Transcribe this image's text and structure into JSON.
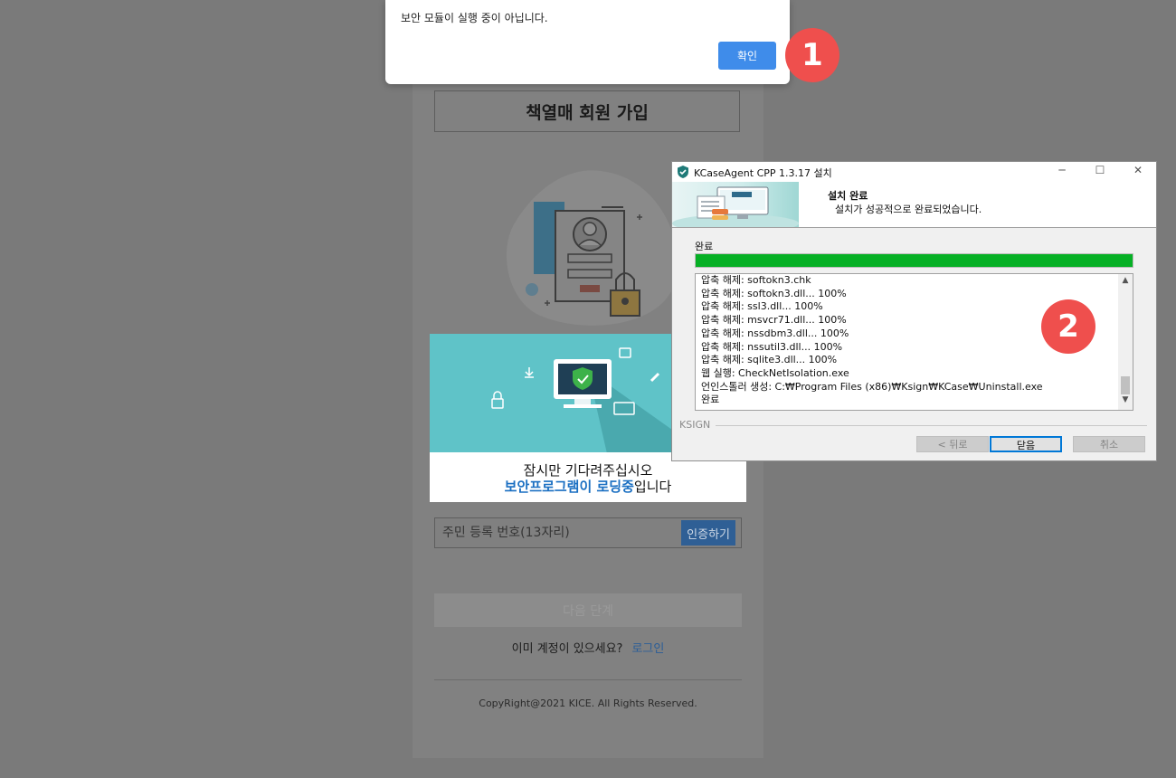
{
  "signup": {
    "title": "책열매 회원 가입",
    "loader_line1": "잠시만 기다려주십시오",
    "loader_highlight": "보안프로그램이 로딩중",
    "loader_suffix": "입니다",
    "id_placeholder": "주민 등록 번호(13자리)",
    "verify_label": "인증하기",
    "next_label": "다음 단계",
    "login_question": "이미 계정이 있으세요?",
    "login_link": "로그인",
    "copyright": "CopyRight@2021 KICE. All Rights Reserved."
  },
  "alert": {
    "message": "보안 모듈이 실행 중이 아닙니다.",
    "ok_label": "확인"
  },
  "badges": [
    "1",
    "2"
  ],
  "installer": {
    "window_title": "KCaseAgent CPP 1.3.17 설치",
    "banner_title": "설치 완료",
    "banner_subtitle": "설치가 성공적으로 완료되었습니다.",
    "status_label": "완료",
    "progress": 1.0,
    "progress_color": "#06b025",
    "log_lines": [
      "압축 해제: softokn3.chk",
      "압축 해제: softokn3.dll... 100%",
      "압축 해제: ssl3.dll... 100%",
      "압축 해제: msvcr71.dll... 100%",
      "압축 해제: nssdbm3.dll... 100%",
      "압축 해제: nssutil3.dll... 100%",
      "압축 해제: sqlite3.dll... 100%",
      "웹 실행: CheckNetIsolation.exe",
      "언인스톨러 생성: C:₩Program Files (x86)₩Ksign₩KCase₩Uninstall.exe",
      "완료"
    ],
    "brand_label": "KSIGN",
    "back_label": "< 뒤로",
    "close_label": "닫음",
    "cancel_label": "취소"
  },
  "colors": {
    "accent_blue": "#3f8cea",
    "badge_red": "#ef4f4d",
    "loader_teal": "#5fc3c8",
    "loading_highlight": "#1a6fc2"
  }
}
